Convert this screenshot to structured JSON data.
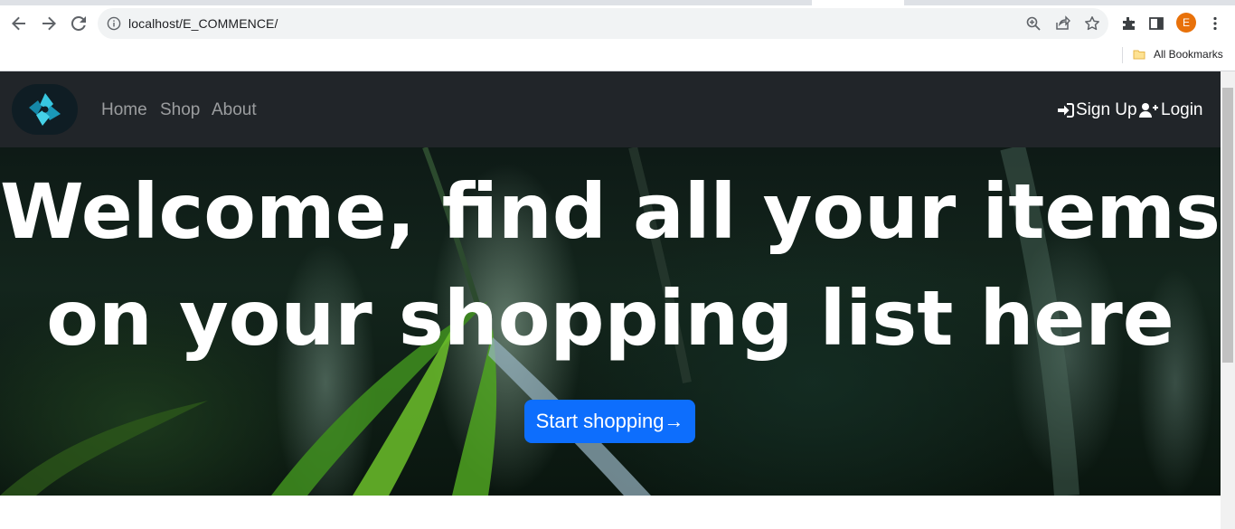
{
  "browser": {
    "url": "localhost/E_COMMENCE/",
    "bookmarks_label": "All Bookmarks",
    "profile_initial": "E"
  },
  "navbar": {
    "links": [
      {
        "label": "Home"
      },
      {
        "label": "Shop"
      },
      {
        "label": "About"
      }
    ],
    "signup_label": "Sign Up",
    "login_label": "Login"
  },
  "hero": {
    "title_line1": "Welcome, find all your items",
    "title_line2": "on your shopping list here",
    "cta_label": "Start shopping→"
  },
  "colors": {
    "navbar_bg": "#212529",
    "cta_bg": "#0d6efd",
    "avatar_bg": "#e8710a"
  }
}
